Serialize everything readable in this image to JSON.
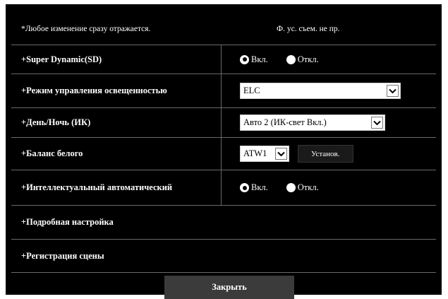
{
  "notice": {
    "left": "*Любое изменение сразу отражается.",
    "right": "Ф. ус. съем. не пр."
  },
  "rows": {
    "super_dynamic": {
      "label": "+Super Dynamic(SD)",
      "option_on": "Вкл.",
      "option_off": "Откл.",
      "selected": "Вкл."
    },
    "light_control": {
      "label": "+Режим управления освещенностью",
      "value": "ELC"
    },
    "day_night": {
      "label": "+День/Ночь (ИК)",
      "value": "Авто 2 (ИК-свет Вкл.)"
    },
    "white_balance": {
      "label": "+Баланс белого",
      "value": "ATW1",
      "set_button": "Установ."
    },
    "intelligent_auto": {
      "label": "+Интеллектуальный автоматический",
      "option_on": "Вкл.",
      "option_off": "Откл.",
      "selected": "Вкл."
    },
    "detailed_settings": {
      "label": "+Подробная настройка"
    },
    "scene_registration": {
      "label": "+Регистрация сцены"
    }
  },
  "close_button": "Закрыть",
  "colors": {
    "panel": "#000000",
    "divider": "#6a6a6a",
    "close_bg": "#3b3b3b"
  }
}
